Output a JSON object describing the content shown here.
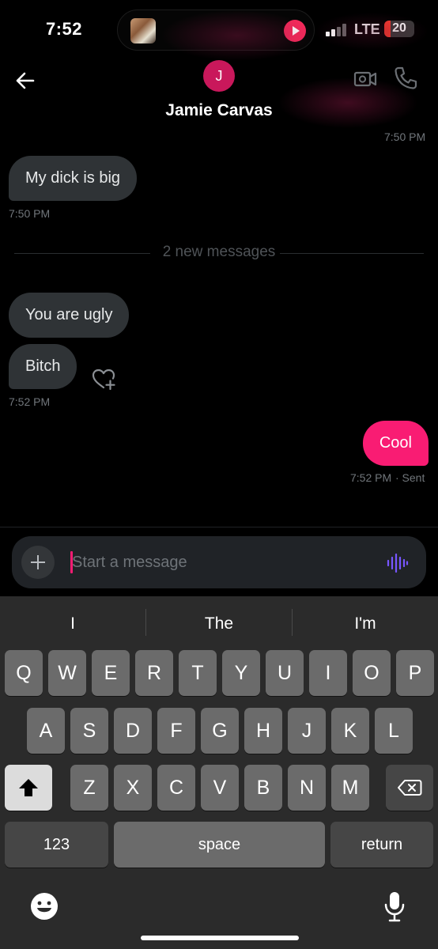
{
  "status_bar": {
    "time": "7:52",
    "network": "LTE",
    "battery_level": "20",
    "battery_color": "#ff3b30",
    "signal_bars_on": 2,
    "signal_bars_total": 4
  },
  "header": {
    "back_icon": "arrow-left-icon",
    "avatar_initial": "J",
    "avatar_color": "#c9185b",
    "contact_name": "Jamie Carvas",
    "video_icon": "video-camera-icon",
    "call_icon": "phone-icon"
  },
  "messages": {
    "prev_timestamp": "7:50 PM",
    "m1": {
      "text": "My dick is big",
      "direction": "incoming",
      "timestamp": "7:50 PM"
    },
    "divider": "2 new messages",
    "m2": {
      "text": "You are ugly",
      "direction": "incoming"
    },
    "m3": {
      "text": "Bitch",
      "direction": "incoming",
      "timestamp": "7:52 PM",
      "reaction_icon": "heart-plus-icon"
    },
    "m4": {
      "text": "Cool",
      "direction": "outgoing",
      "timestamp": "7:52 PM",
      "status": "· Sent"
    }
  },
  "composer": {
    "placeholder": "Start a message",
    "add_icon": "plus-icon",
    "voice_icon": "voice-wave-icon"
  },
  "keyboard": {
    "suggestions": [
      "I",
      "The",
      "I'm"
    ],
    "row1": [
      "Q",
      "W",
      "E",
      "R",
      "T",
      "Y",
      "U",
      "I",
      "O",
      "P"
    ],
    "row2": [
      "A",
      "S",
      "D",
      "F",
      "G",
      "H",
      "J",
      "K",
      "L"
    ],
    "row3": [
      "Z",
      "X",
      "C",
      "V",
      "B",
      "N",
      "M"
    ],
    "numbers_label": "123",
    "space_label": "space",
    "return_label": "return",
    "shift_icon": "shift-icon",
    "delete_icon": "backspace-icon",
    "emoji_icon": "emoji-icon",
    "mic_icon": "microphone-icon"
  },
  "colors": {
    "accent": "#f91c73",
    "incoming_bubble": "#2f3336",
    "voice_icon": "#7856ff"
  }
}
